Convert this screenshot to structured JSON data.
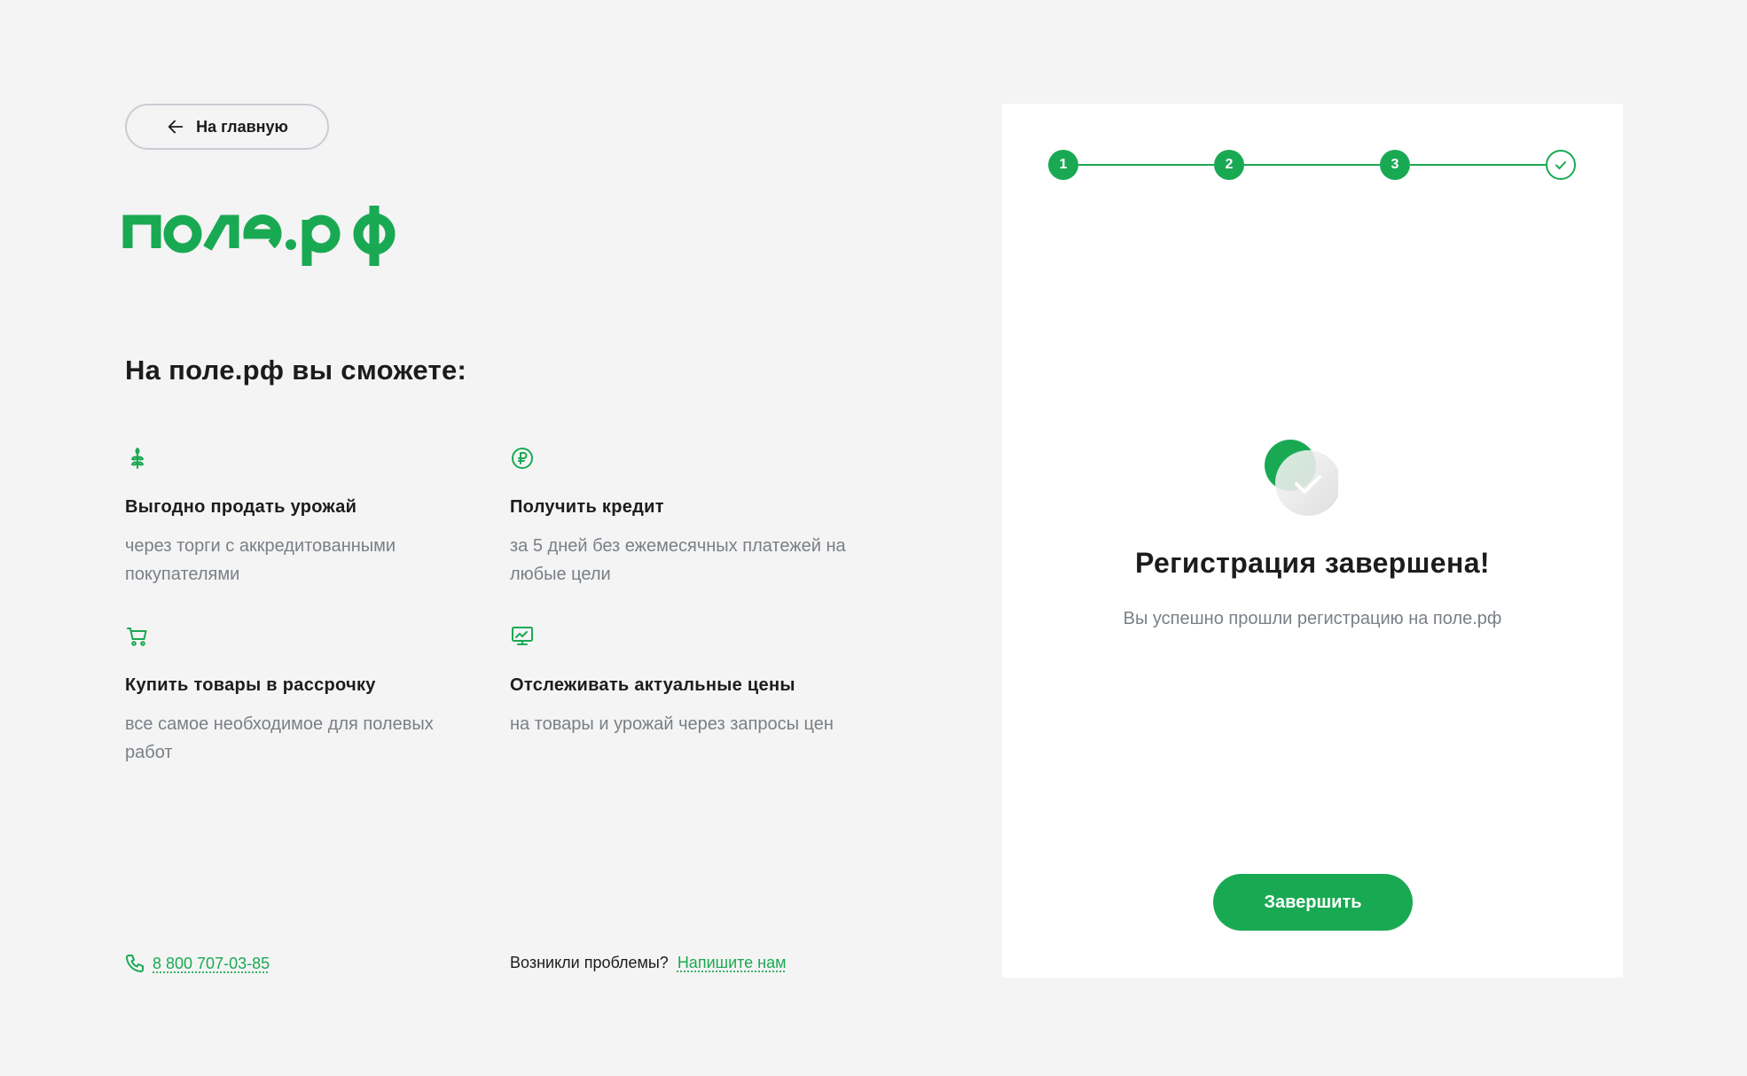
{
  "back_button": {
    "label": "На главную"
  },
  "brand": {
    "logo_text": "поле.рф",
    "accent_color": "#1aa953"
  },
  "left": {
    "title": "На поле.рф вы сможете:",
    "features": [
      {
        "icon": "wheat-icon",
        "title": "Выгодно продать урожай",
        "desc": "через торги с аккредитованными покупателями"
      },
      {
        "icon": "ruble-coin-icon",
        "title": "Получить кредит",
        "desc": "за 5 дней без ежемесячных платежей на любые цели"
      },
      {
        "icon": "cart-icon",
        "title": "Купить товары в рассрочку",
        "desc": "все самое необходимое для полевых работ"
      },
      {
        "icon": "chart-monitor-icon",
        "title": "Отслеживать актуальные цены",
        "desc": "на товары и урожай через запросы цен"
      }
    ]
  },
  "footer": {
    "phone": "8 800 707-03-85",
    "help_text": "Возникли проблемы?",
    "help_link": "Напишите нам"
  },
  "card": {
    "steps": [
      "1",
      "2",
      "3"
    ],
    "final_step_icon": "check-icon",
    "title": "Регистрация завершена!",
    "subtitle": "Вы успешно прошли регистрацию на поле.рф",
    "finish_button": "Завершить"
  }
}
